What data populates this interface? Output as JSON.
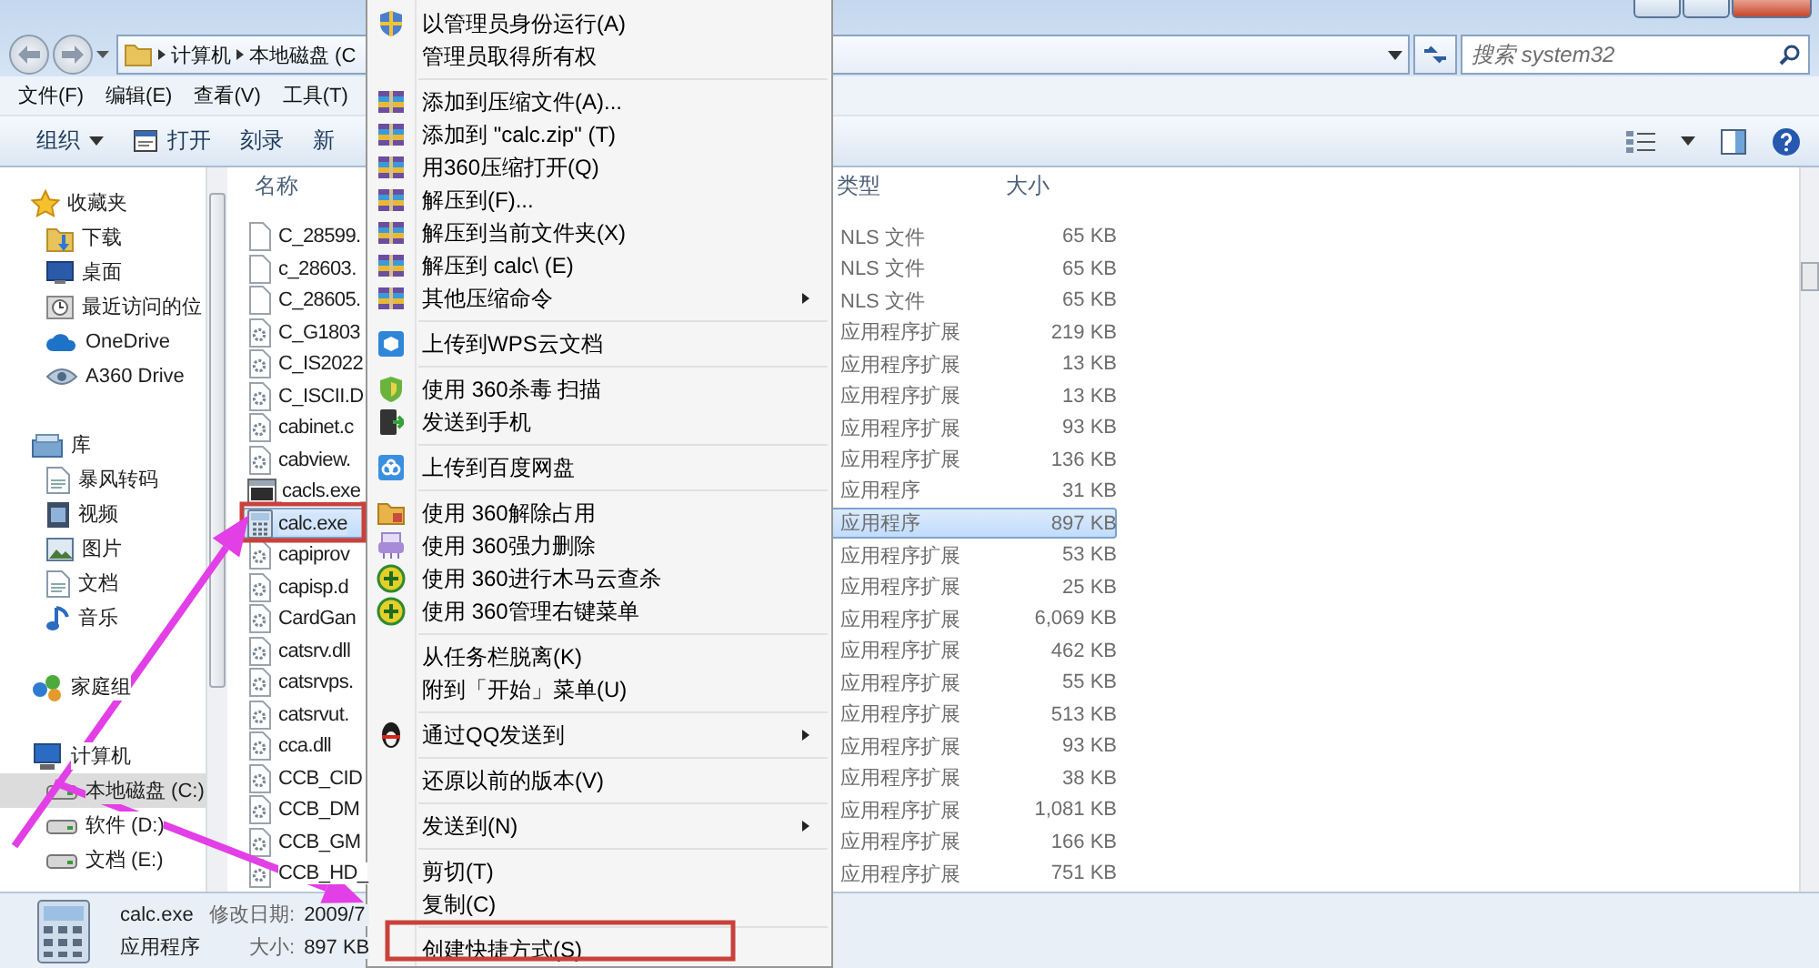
{
  "address_bar": {
    "crumbs": [
      "计算机",
      "本地磁盘 (C"
    ]
  },
  "search": {
    "placeholder": "搜索 system32"
  },
  "menu_bar": [
    "文件(F)",
    "编辑(E)",
    "查看(V)",
    "工具(T)"
  ],
  "toolbar": {
    "buttons": [
      {
        "label": "组织",
        "kind": "dropdown"
      },
      {
        "label": "打开",
        "kind": "icon"
      },
      {
        "label": "刻录",
        "kind": "plain"
      },
      {
        "label": "新",
        "kind": "plain"
      }
    ]
  },
  "nav_pane": {
    "groups": [
      {
        "label": "收藏夹",
        "selected": false,
        "children": [
          {
            "label": "下载",
            "selected": false
          },
          {
            "label": "桌面",
            "selected": false
          },
          {
            "label": "最近访问的位",
            "selected": false
          },
          {
            "label": "OneDrive",
            "selected": false
          },
          {
            "label": "A360 Drive",
            "selected": false
          }
        ]
      },
      {
        "label": "库",
        "selected": false,
        "children": [
          {
            "label": "暴风转码",
            "selected": false
          },
          {
            "label": "视频",
            "selected": false
          },
          {
            "label": "图片",
            "selected": false
          },
          {
            "label": "文档",
            "selected": false
          },
          {
            "label": "音乐",
            "selected": false
          }
        ]
      },
      {
        "label": "家庭组",
        "selected": false
      },
      {
        "label": "计算机",
        "selected": false,
        "children": [
          {
            "label": "本地磁盘 (C:)",
            "selected": true
          },
          {
            "label": "软件 (D:)",
            "selected": false
          },
          {
            "label": "文档 (E:)",
            "selected": false
          }
        ]
      }
    ]
  },
  "file_list": {
    "columns": [
      "名称",
      "类型",
      "大小"
    ],
    "rows": [
      {
        "name": "C_28599.",
        "type": "NLS 文件",
        "size": "65 KB",
        "kind": "document",
        "selected": false
      },
      {
        "name": "c_28603.",
        "type": "NLS 文件",
        "size": "65 KB",
        "kind": "document",
        "selected": false
      },
      {
        "name": "C_28605.",
        "type": "NLS 文件",
        "size": "65 KB",
        "kind": "document",
        "selected": false
      },
      {
        "name": "C_G1803",
        "type": "应用程序扩展",
        "size": "219 KB",
        "kind": "library",
        "selected": false
      },
      {
        "name": "C_IS2022",
        "type": "应用程序扩展",
        "size": "13 KB",
        "kind": "library",
        "selected": false
      },
      {
        "name": "C_ISCII.D",
        "type": "应用程序扩展",
        "size": "13 KB",
        "kind": "library",
        "selected": false
      },
      {
        "name": "cabinet.c",
        "type": "应用程序扩展",
        "size": "93 KB",
        "kind": "library",
        "selected": false
      },
      {
        "name": "cabview.",
        "type": "应用程序扩展",
        "size": "136 KB",
        "kind": "library",
        "selected": false
      },
      {
        "name": "cacls.exe",
        "type": "应用程序",
        "size": "31 KB",
        "kind": "console",
        "selected": false
      },
      {
        "name": "calc.exe",
        "type": "应用程序",
        "size": "897 KB",
        "kind": "calculator",
        "selected": true
      },
      {
        "name": "capiprov",
        "type": "应用程序扩展",
        "size": "53 KB",
        "kind": "library",
        "selected": false
      },
      {
        "name": "capisp.d",
        "type": "应用程序扩展",
        "size": "25 KB",
        "kind": "library",
        "selected": false
      },
      {
        "name": "CardGan",
        "type": "应用程序扩展",
        "size": "6,069 KB",
        "kind": "library",
        "selected": false
      },
      {
        "name": "catsrv.dll",
        "type": "应用程序扩展",
        "size": "462 KB",
        "kind": "library",
        "selected": false
      },
      {
        "name": "catsrvps.",
        "type": "应用程序扩展",
        "size": "55 KB",
        "kind": "library",
        "selected": false
      },
      {
        "name": "catsrvut.",
        "type": "应用程序扩展",
        "size": "513 KB",
        "kind": "library",
        "selected": false
      },
      {
        "name": "cca.dll",
        "type": "应用程序扩展",
        "size": "93 KB",
        "kind": "library",
        "selected": false
      },
      {
        "name": "CCB_CID",
        "type": "应用程序扩展",
        "size": "38 KB",
        "kind": "library",
        "selected": false
      },
      {
        "name": "CCB_DM",
        "type": "应用程序扩展",
        "size": "1,081 KB",
        "kind": "library",
        "selected": false
      },
      {
        "name": "CCB_GM",
        "type": "应用程序扩展",
        "size": "166 KB",
        "kind": "library",
        "selected": false
      },
      {
        "name": "CCB_HD_",
        "type": "应用程序扩展",
        "size": "751 KB",
        "kind": "library",
        "selected": false
      }
    ]
  },
  "details": {
    "name": "calc.exe",
    "modified_label": "修改日期:",
    "modified": "2009/7",
    "type": "应用程序",
    "size_label": "大小:",
    "size": "897 KB"
  },
  "context_menu": {
    "items": [
      {
        "kind": "item",
        "label": "以管理员身份运行(A)",
        "submenu": false
      },
      {
        "kind": "item",
        "label": "管理员取得所有权",
        "submenu": false
      },
      {
        "kind": "separator"
      },
      {
        "kind": "item",
        "label": "添加到压缩文件(A)...",
        "submenu": false
      },
      {
        "kind": "item",
        "label": "添加到 \"calc.zip\" (T)",
        "submenu": false
      },
      {
        "kind": "item",
        "label": "用360压缩打开(Q)",
        "submenu": false
      },
      {
        "kind": "item",
        "label": "解压到(F)...",
        "submenu": false
      },
      {
        "kind": "item",
        "label": "解压到当前文件夹(X)",
        "submenu": false
      },
      {
        "kind": "item",
        "label": "解压到 calc\\ (E)",
        "submenu": false
      },
      {
        "kind": "item",
        "label": "其他压缩命令",
        "submenu": true
      },
      {
        "kind": "separator"
      },
      {
        "kind": "item",
        "label": "上传到WPS云文档",
        "submenu": false
      },
      {
        "kind": "separator"
      },
      {
        "kind": "item",
        "label": "使用 360杀毒 扫描",
        "submenu": false
      },
      {
        "kind": "item",
        "label": "发送到手机",
        "submenu": false
      },
      {
        "kind": "separator"
      },
      {
        "kind": "item",
        "label": "上传到百度网盘",
        "submenu": false
      },
      {
        "kind": "separator"
      },
      {
        "kind": "item",
        "label": "使用 360解除占用",
        "submenu": false
      },
      {
        "kind": "item",
        "label": "使用 360强力删除",
        "submenu": false
      },
      {
        "kind": "item",
        "label": "使用 360进行木马云查杀",
        "submenu": false
      },
      {
        "kind": "item",
        "label": "使用 360管理右键菜单",
        "submenu": false
      },
      {
        "kind": "separator"
      },
      {
        "kind": "item",
        "label": "从任务栏脱离(K)",
        "submenu": false
      },
      {
        "kind": "item",
        "label": "附到「开始」菜单(U)",
        "submenu": false
      },
      {
        "kind": "separator"
      },
      {
        "kind": "item",
        "label": "通过QQ发送到",
        "submenu": true
      },
      {
        "kind": "separator"
      },
      {
        "kind": "item",
        "label": "还原以前的版本(V)",
        "submenu": false
      },
      {
        "kind": "separator"
      },
      {
        "kind": "item",
        "label": "发送到(N)",
        "submenu": true
      },
      {
        "kind": "separator"
      },
      {
        "kind": "item",
        "label": "剪切(T)",
        "submenu": false
      },
      {
        "kind": "item",
        "label": "复制(C)",
        "submenu": false
      },
      {
        "kind": "separator"
      },
      {
        "kind": "item",
        "label": "创建快捷方式(S)",
        "submenu": false
      }
    ]
  }
}
